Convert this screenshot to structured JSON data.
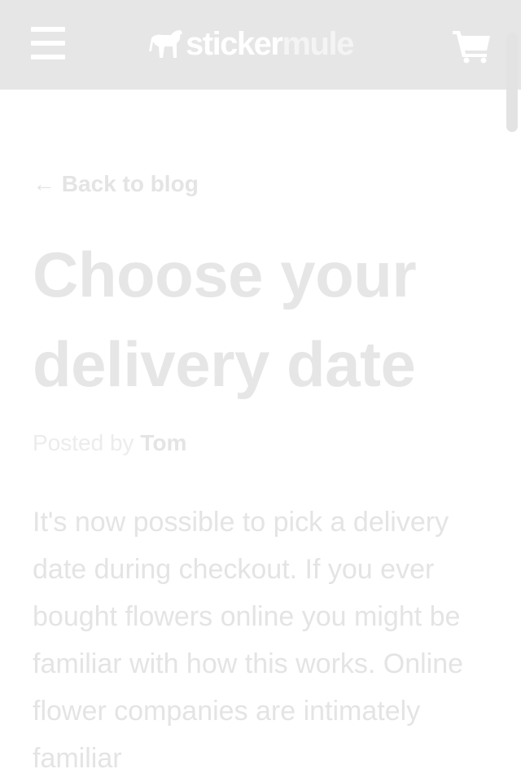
{
  "header": {
    "menu_icon": "hamburger-menu-icon",
    "logo": {
      "part1": "sticker",
      "part2": "mule",
      "icon": "mule-logo-icon"
    },
    "cart_icon": "shopping-cart-icon",
    "colors": {
      "background": "#e6e6e6",
      "foreground": "#ffffff"
    }
  },
  "article": {
    "back_link": "← Back to blog",
    "title": "Choose your delivery date",
    "byline_prefix": "Posted by",
    "author": "Tom",
    "body": "It's now possible to pick a delivery date during checkout. If you ever bought flowers online you might be familiar with how this works. Online flower companies are intimately familiar"
  }
}
